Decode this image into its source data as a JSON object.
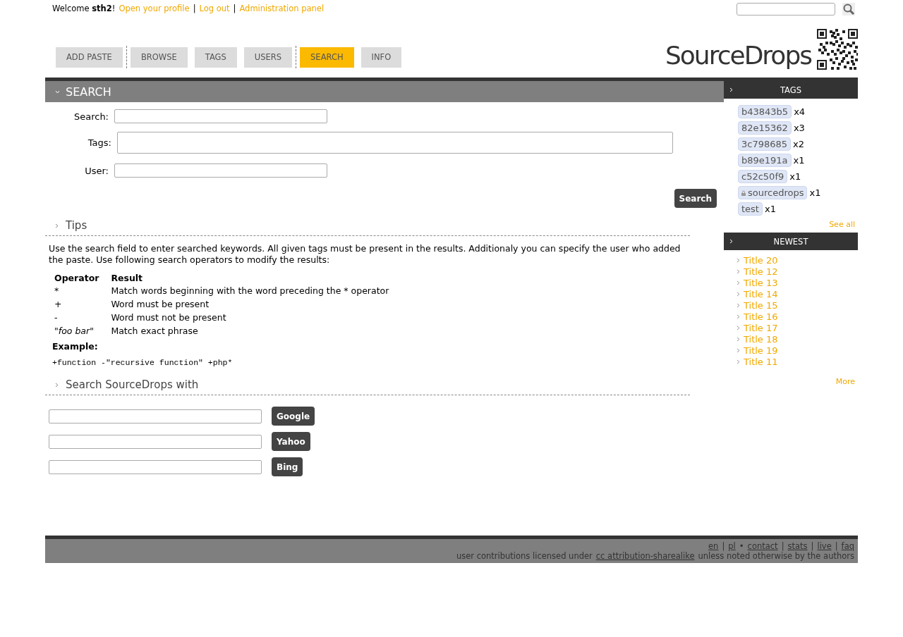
{
  "top_bar": {
    "welcome": "Welcome **sth2**!",
    "links": [
      {
        "kind": "link",
        "text": "Open your profile"
      },
      {
        "kind": "sep",
        "text": "|"
      },
      {
        "kind": "link",
        "text": "Log out"
      },
      {
        "kind": "sep",
        "text": "|"
      },
      {
        "kind": "link",
        "text": "Administration panel"
      }
    ]
  },
  "logo": {
    "text": "SourceDrops"
  },
  "nav": [
    {
      "kind": "tab",
      "label": "ADD PASTE",
      "selected": false
    },
    {
      "kind": "divider"
    },
    {
      "kind": "tab",
      "label": "BROWSE",
      "selected": false
    },
    {
      "kind": "tab",
      "label": "TAGS",
      "selected": false
    },
    {
      "kind": "tab",
      "label": "USERS",
      "selected": false
    },
    {
      "kind": "divider"
    },
    {
      "kind": "tab",
      "label": "SEARCH",
      "selected": true
    },
    {
      "kind": "tab",
      "label": "INFO",
      "selected": false
    }
  ],
  "search_section": {
    "title": "SEARCH",
    "fields": [
      {
        "label": "Search:",
        "kind": "short"
      },
      {
        "label": "Tags:",
        "kind": "wide"
      },
      {
        "label": "User:",
        "kind": "short"
      }
    ],
    "button": "Search"
  },
  "tips": {
    "title": "Tips",
    "intro": "Use the search field to enter searched keywords. All given tags must be present in the results. Additionaly you can specify the user who added the paste. Use following search operators to modify the results:",
    "columns": [
      "Operator",
      "Result"
    ],
    "rows": [
      [
        "*",
        "Match words beginning with the word preceding the * operator"
      ],
      [
        "+",
        "Word must be present"
      ],
      [
        "-",
        "Word must not be present"
      ],
      [
        "\"*foo bar*\"",
        "Match exact phrase"
      ]
    ],
    "example_label": "Example:",
    "example": "+function -\"recursive function\" +php*"
  },
  "external": {
    "title": "Search SourceDrops with",
    "engines": [
      "Google",
      "Yahoo",
      "Bing"
    ]
  },
  "sidebar": {
    "tags_title": "TAGS",
    "tags": [
      {
        "name": "b43843b5",
        "count": "x4",
        "locked": false
      },
      {
        "name": "82e15362",
        "count": "x3",
        "locked": false
      },
      {
        "name": "3c798685",
        "count": "x2",
        "locked": false
      },
      {
        "name": "b89e191a",
        "count": "x1",
        "locked": false
      },
      {
        "name": "c52c50f9",
        "count": "x1",
        "locked": false
      },
      {
        "name": "sourcedrops",
        "count": "x1",
        "locked": true
      },
      {
        "name": "test",
        "count": "x1",
        "locked": false
      }
    ],
    "see_all": "See all",
    "newest_title": "NEWEST",
    "newest": [
      "Title 20",
      "Title 12",
      "Title 13",
      "Title 14",
      "Title 15",
      "Title 16",
      "Title 17",
      "Title 18",
      "Title 19",
      "Title 11"
    ],
    "more": "More"
  },
  "footer": {
    "line1": [
      {
        "kind": "link",
        "text": "en"
      },
      {
        "kind": "sep",
        "text": "|"
      },
      {
        "kind": "link",
        "text": "pl"
      },
      {
        "kind": "sep",
        "text": "•"
      },
      {
        "kind": "link",
        "text": "contact"
      },
      {
        "kind": "sep",
        "text": "|"
      },
      {
        "kind": "link",
        "text": "stats"
      },
      {
        "kind": "sep",
        "text": "|"
      },
      {
        "kind": "link",
        "text": "live"
      },
      {
        "kind": "sep",
        "text": "|"
      },
      {
        "kind": "link",
        "text": "faq"
      }
    ],
    "line2": {
      "before": "user contributions licensed under",
      "link": "cc attribution-sharealike",
      "after": "unless noted otherwise by the authors"
    }
  }
}
